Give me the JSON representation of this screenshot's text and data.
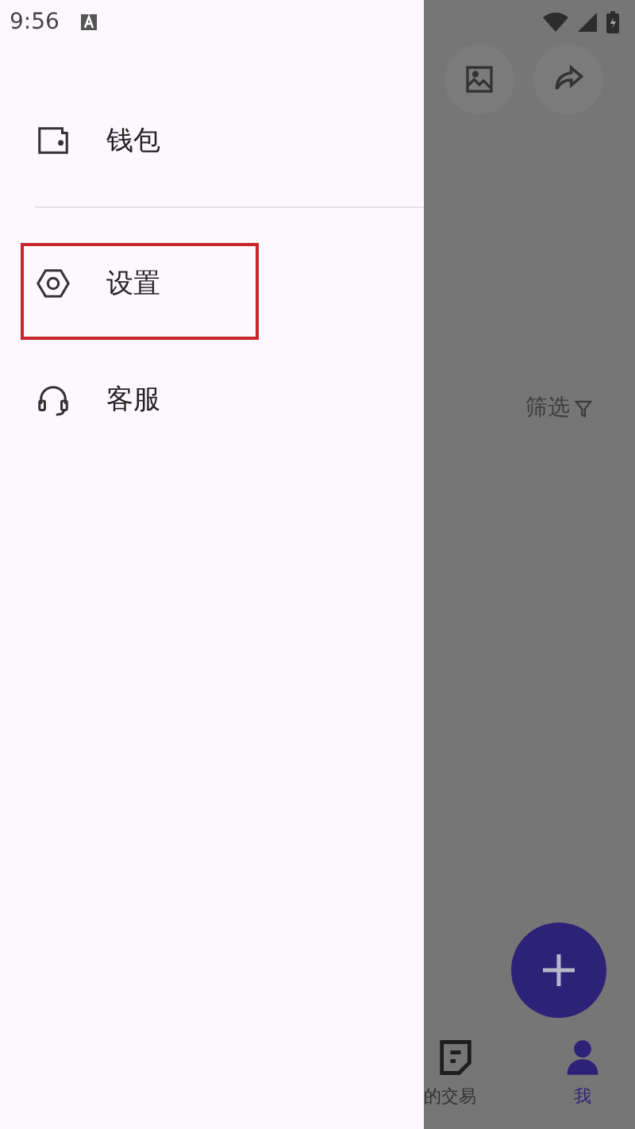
{
  "status_bar": {
    "time": "9:56"
  },
  "drawer": {
    "items": [
      {
        "label": "钱包",
        "kind": "wallet",
        "annotated": false
      },
      {
        "label": "设置",
        "kind": "settings",
        "annotated": true
      },
      {
        "label": "客服",
        "kind": "support",
        "annotated": false
      }
    ]
  },
  "background_screen": {
    "filter_label": "筛选",
    "bottom_nav": [
      {
        "label": "的交易",
        "kind": "trades",
        "selected": false
      },
      {
        "label": "我",
        "kind": "me",
        "selected": true
      }
    ]
  }
}
